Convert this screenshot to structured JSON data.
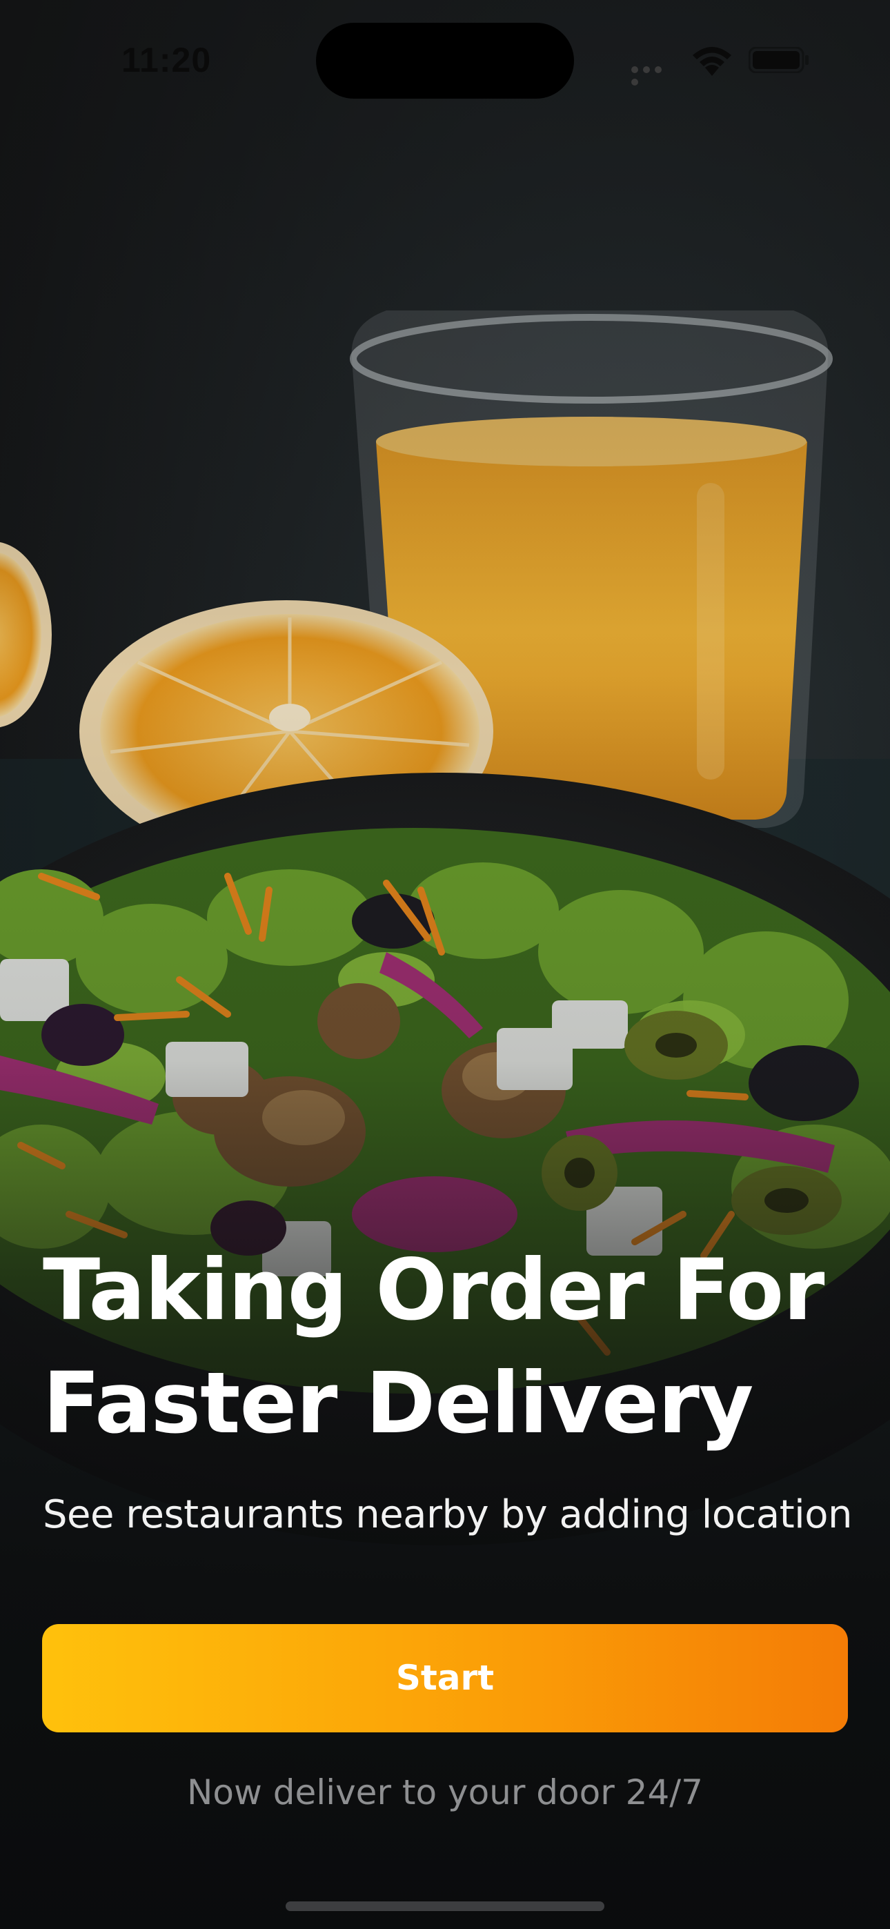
{
  "status_bar": {
    "time": "11:20",
    "icons": [
      "signal-icon",
      "wifi-icon",
      "battery-icon"
    ]
  },
  "hero_image": {
    "depicts": [
      "orange-juice-glass",
      "orange-halves",
      "salad-bowl"
    ]
  },
  "onboarding": {
    "headline_line1": "Taking Order For",
    "headline_line2": "Faster Delivery",
    "subtitle": "See restaurants nearby by adding location",
    "start_label": "Start",
    "footnote": "Now deliver to your door 24/7"
  },
  "colors": {
    "button_gradient_start": "#ffc10c",
    "button_gradient_end": "#f47c06",
    "text_primary": "#ffffff",
    "text_muted": "#8e8f91",
    "background": "#17191b"
  }
}
